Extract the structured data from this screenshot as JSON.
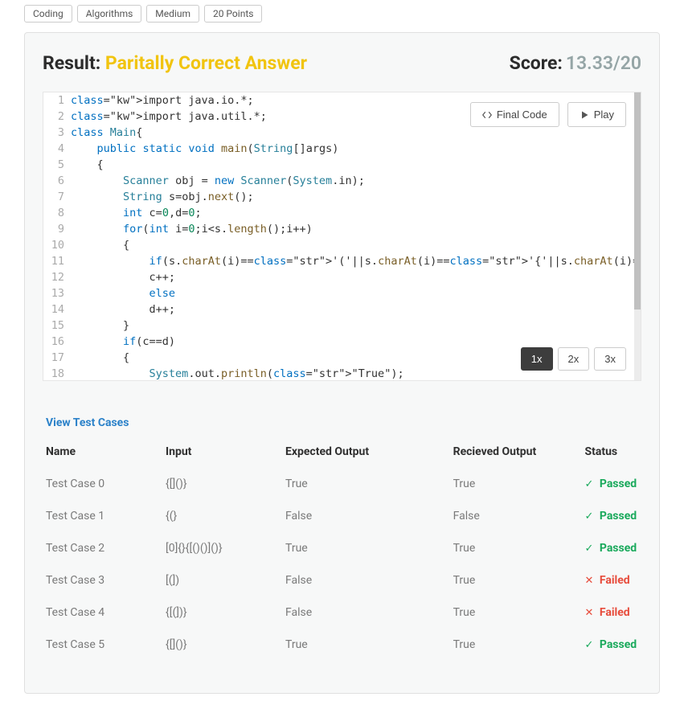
{
  "tags": [
    "Coding",
    "Algorithms",
    "Medium",
    "20 Points"
  ],
  "result": {
    "label": "Result:",
    "status": "Paritally Correct Answer",
    "score_label": "Score:",
    "score_value": "13.33/20"
  },
  "buttons": {
    "final_code": "Final Code",
    "play": "Play"
  },
  "speeds": [
    "1x",
    "2x",
    "3x"
  ],
  "active_speed": 0,
  "code_lines": [
    {
      "n": 1,
      "raw": "import java.io.*;"
    },
    {
      "n": 2,
      "raw": "import java.util.*;"
    },
    {
      "n": 3,
      "raw": "class Main{"
    },
    {
      "n": 4,
      "raw": "    public static void main(String[]args)"
    },
    {
      "n": 5,
      "raw": "    {"
    },
    {
      "n": 6,
      "raw": "        Scanner obj = new Scanner(System.in);"
    },
    {
      "n": 7,
      "raw": "        String s=obj.next();"
    },
    {
      "n": 8,
      "raw": "        int c=0,d=0;"
    },
    {
      "n": 9,
      "raw": "        for(int i=0;i<s.length();i++)"
    },
    {
      "n": 10,
      "raw": "        {"
    },
    {
      "n": 11,
      "raw": "            if(s.charAt(i)=='('||s.charAt(i)=='{'||s.charAt(i)=='[')"
    },
    {
      "n": 12,
      "raw": "            c++;"
    },
    {
      "n": 13,
      "raw": "            else"
    },
    {
      "n": 14,
      "raw": "            d++;"
    },
    {
      "n": 15,
      "raw": "        }"
    },
    {
      "n": 16,
      "raw": "        if(c==d)"
    },
    {
      "n": 17,
      "raw": "        {"
    },
    {
      "n": 18,
      "raw": "            System.out.println(\"True\");"
    }
  ],
  "view_tc": "View Test Cases",
  "headers": {
    "name": "Name",
    "input": "Input",
    "expected": "Expected Output",
    "received": "Recieved Output",
    "status": "Status"
  },
  "tests": [
    {
      "name": "Test Case 0",
      "input": "{[]()}",
      "expected": "True",
      "received": "True",
      "status": "Passed"
    },
    {
      "name": "Test Case 1",
      "input": "{(}",
      "expected": "False",
      "received": "False",
      "status": "Passed"
    },
    {
      "name": "Test Case 2",
      "input": "[0]{}{[()()]()}",
      "expected": "True",
      "received": "True",
      "status": "Passed"
    },
    {
      "name": "Test Case 3",
      "input": "[(])",
      "expected": "False",
      "received": "True",
      "status": "Failed"
    },
    {
      "name": "Test Case 4",
      "input": "{[(])}",
      "expected": "False",
      "received": "True",
      "status": "Failed"
    },
    {
      "name": "Test Case 5",
      "input": "{[]()}",
      "expected": "True",
      "received": "True",
      "status": "Passed"
    }
  ]
}
